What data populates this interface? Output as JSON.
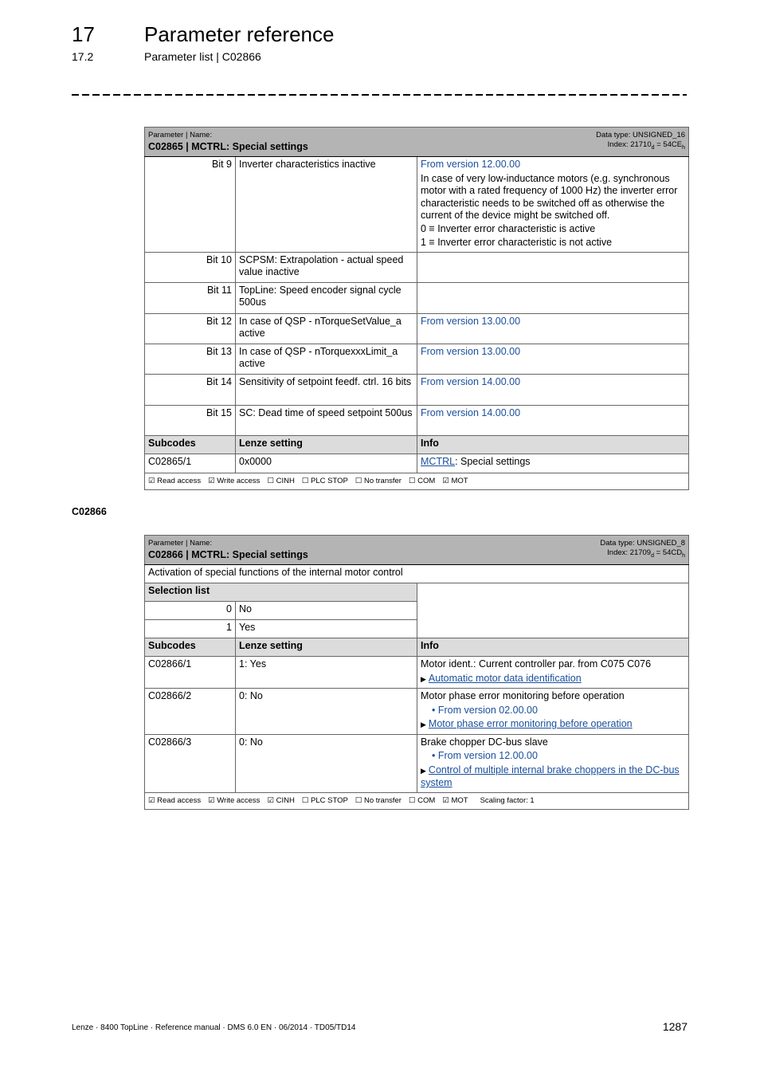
{
  "header": {
    "chapter_number": "17",
    "chapter_title": "Parameter reference",
    "section_number": "17.2",
    "section_title": "Parameter list | C02866"
  },
  "table1": {
    "label": "Parameter | Name:",
    "name": "C02865 | MCTRL: Special settings",
    "data_type": "Data type: UNSIGNED_16",
    "index_prefix": "Index: 21710",
    "index_d": "d",
    "index_mid": " = 54CE",
    "index_h": "h",
    "bits": [
      {
        "bit": "Bit 9",
        "desc": "Inverter characteristics inactive",
        "version": "From version 12.00.00",
        "info": "In case of very low-inductance motors (e.g. synchronous motor with a rated frequency of 1000 Hz) the inverter error characteristic needs to be switched off as otherwise the current of the device might be switched off.",
        "info_0": "0 ≡ Inverter error characteristic is active",
        "info_1": "1 ≡ Inverter error characteristic is not active"
      },
      {
        "bit": "Bit 10",
        "desc": "SCPSM: Extrapolation - actual speed value inactive",
        "version": ""
      },
      {
        "bit": "Bit 11",
        "desc": "TopLine: Speed encoder signal cycle 500us",
        "version": ""
      },
      {
        "bit": "Bit 12",
        "desc": "In case of QSP - nTorqueSetValue_a active",
        "version": "From version 13.00.00"
      },
      {
        "bit": "Bit 13",
        "desc": "In case of QSP - nTorquexxxLimit_a active",
        "version": "From version 13.00.00"
      },
      {
        "bit": "Bit 14",
        "desc": "Sensitivity of setpoint feedf. ctrl. 16 bits",
        "version": "From version 14.00.00"
      },
      {
        "bit": "Bit 15",
        "desc": "SC: Dead time of speed setpoint 500us",
        "version": "From version 14.00.00"
      }
    ],
    "sub_headers": {
      "subcodes": "Subcodes",
      "lenze": "Lenze setting",
      "info": "Info"
    },
    "subcodes": [
      {
        "code": "C02865/1",
        "setting": "0x0000",
        "info_link": "MCTRL",
        "info_text": ": Special settings"
      }
    ],
    "footer": [
      "☑ Read access",
      "☑ Write access",
      "☐ CINH",
      "☐ PLC STOP",
      "☐ No transfer",
      "☐ COM",
      "☑ MOT"
    ]
  },
  "subheading": "C02866",
  "table2": {
    "label": "Parameter | Name:",
    "name": "C02866 | MCTRL: Special settings",
    "data_type": "Data type: UNSIGNED_8",
    "index_prefix": "Index: 21709",
    "index_d": "d",
    "index_mid": " = 54CD",
    "index_h": "h",
    "description": "Activation of special functions of the internal motor control",
    "selection_header": "Selection list",
    "selection": [
      {
        "value": "0",
        "label": "No"
      },
      {
        "value": "1",
        "label": "Yes"
      }
    ],
    "sub_headers": {
      "subcodes": "Subcodes",
      "lenze": "Lenze setting",
      "info": "Info"
    },
    "subcodes": [
      {
        "code": "C02866/1",
        "setting": "1: Yes",
        "info": "Motor ident.: Current controller par. from C075 C076",
        "version": "",
        "link": "Automatic motor data identification"
      },
      {
        "code": "C02866/2",
        "setting": "0: No",
        "info": "Motor phase error monitoring before operation",
        "version": "From version 02.00.00",
        "link": "Motor phase error monitoring before operation"
      },
      {
        "code": "C02866/3",
        "setting": "0: No",
        "info": "Brake chopper DC-bus slave",
        "version": "From version 12.00.00",
        "link": "Control of multiple internal brake choppers in the DC-bus system"
      }
    ],
    "footer": [
      "☑ Read access",
      "☑ Write access",
      "☑ CINH",
      "☐ PLC STOP",
      "☐ No transfer",
      "☐ COM",
      "☑ MOT",
      "Scaling factor: 1"
    ]
  },
  "footer": {
    "left": "Lenze · 8400 TopLine · Reference manual · DMS 6.0 EN · 06/2014 · TD05/TD14",
    "page": "1287"
  }
}
